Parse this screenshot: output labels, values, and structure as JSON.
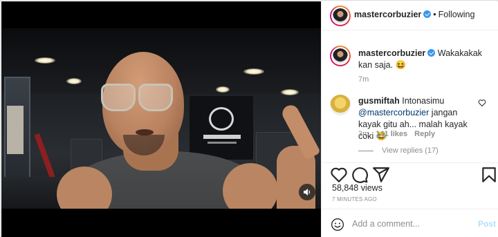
{
  "post": {
    "author": "mastercorbuzier",
    "follow_label": "Following",
    "caption": {
      "username": "mastercorbuzier",
      "text": "Wakakakak kan saja. 😆",
      "age": "7m"
    },
    "comments": [
      {
        "username": "gusmiftah",
        "text_before": "Intonasimu ",
        "mention": "@mastercorbuzier",
        "text_after": " jangan kayak gitu ah... malah kayak coki 😂",
        "age": "3m",
        "likes": "141 likes",
        "reply_label": "Reply",
        "view_replies": "View replies (17)"
      }
    ],
    "views": "58,848 views",
    "posted": "7 MINUTES AGO"
  },
  "add_comment": {
    "placeholder": "Add a comment...",
    "post_label": "Post"
  },
  "icons": {
    "like": "heart-icon",
    "comment": "comment-icon",
    "share": "send-icon",
    "save": "bookmark-icon",
    "mute": "volume-icon",
    "emoji": "emoji-icon"
  },
  "colors": {
    "verified": "#3897f0",
    "link": "#00376b",
    "muted_text": "#8e8e8e",
    "post_button_disabled": "#b2dffc"
  }
}
